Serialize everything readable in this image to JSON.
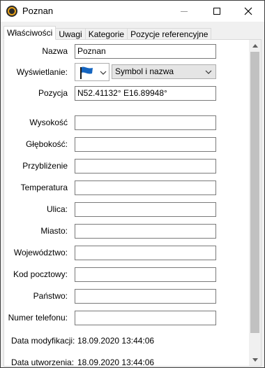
{
  "window": {
    "title": "Poznan",
    "icon": "app-icon",
    "controls": [
      "minimize-icon",
      "maximize-icon",
      "close-icon"
    ]
  },
  "tabs": [
    {
      "label": "Właściwości",
      "active": true
    },
    {
      "label": "Uwagi",
      "active": false
    },
    {
      "label": "Kategorie",
      "active": false
    },
    {
      "label": "Pozycje referencyjne",
      "active": false
    }
  ],
  "form": {
    "name": {
      "label": "Nazwa",
      "value": "Poznan"
    },
    "display": {
      "label": "Wyświetlanie:",
      "icon": "blue-flag-icon",
      "option": "Symbol i nazwa"
    },
    "position": {
      "label": "Pozycja",
      "value": "N52.41132° E16.89948°"
    },
    "altitude": {
      "label": "Wysokość",
      "value": ""
    },
    "depth": {
      "label": "Głębokość:",
      "value": ""
    },
    "proximity": {
      "label": "Przybliżenie",
      "value": ""
    },
    "temperature": {
      "label": "Temperatura",
      "value": ""
    },
    "street": {
      "label": "Ulica:",
      "value": ""
    },
    "city": {
      "label": "Miasto:",
      "value": ""
    },
    "state": {
      "label": "Województwo:",
      "value": ""
    },
    "postal": {
      "label": "Kod pocztowy:",
      "value": ""
    },
    "country": {
      "label": "Państwo:",
      "value": ""
    },
    "phone": {
      "label": "Numer telefonu:",
      "value": ""
    },
    "modified": {
      "label": "Data modyfikacji:",
      "value": "18.09.2020 13:44:06"
    },
    "created": {
      "label": "Data utworzenia:",
      "value": "18.09.2020 13:44:06"
    }
  },
  "colors": {
    "flag": "#1565c0",
    "scroll_thumb": "#c1c1c1"
  }
}
